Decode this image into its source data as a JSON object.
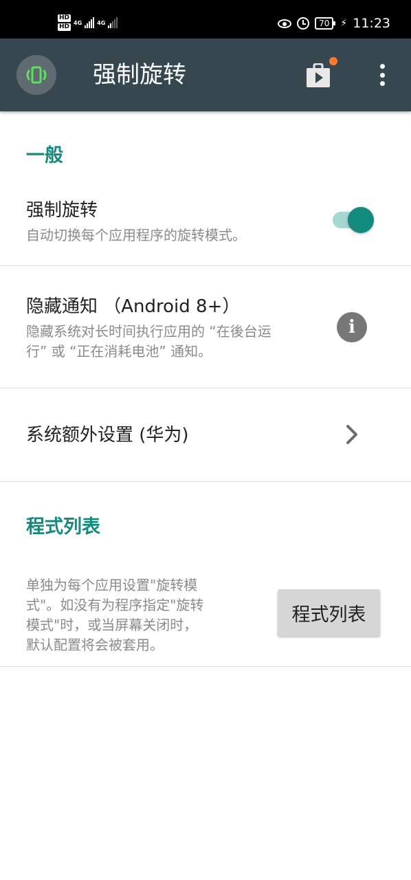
{
  "status_bar": {
    "hd1": "HD",
    "hd2": "HD",
    "net1": "4G",
    "net2": "4G",
    "battery": "70",
    "time": "11:23"
  },
  "toolbar": {
    "title": "强制旋转",
    "app_icon": "rotation-icon",
    "store_icon": "play-store-icon",
    "menu_icon": "more-vert-icon",
    "accent": "#37474f"
  },
  "general": {
    "header": "一般",
    "force_rotation": {
      "title": "强制旋转",
      "subtitle": "自动切换每个应用程序的旋转模式。",
      "enabled": true
    },
    "hide_notification": {
      "title": "隐藏通知 （Android 8+）",
      "subtitle_line1": "隐藏系统对长时间执行应用的 “在後台运",
      "subtitle_line2": "行” 或 “正在消耗电池” 通知。",
      "icon": "info-icon"
    },
    "extra_settings": {
      "title": "系统额外设置 (华为)",
      "icon": "chevron-right-icon"
    }
  },
  "app_list": {
    "header": "程式列表",
    "desc_line1": "单独为每个应用设置\"旋转模",
    "desc_line2": "式\"。如没有为程序指定\"旋转",
    "desc_line3": "模式\"时，或当屏幕关闭时，",
    "desc_line4": "默认配置将会被套用。",
    "button": "程式列表"
  },
  "colors": {
    "accent": "#138a7e",
    "switch_track": "#a5d6d1",
    "toolbar": "#37474f",
    "badge": "#ff7a2f"
  }
}
